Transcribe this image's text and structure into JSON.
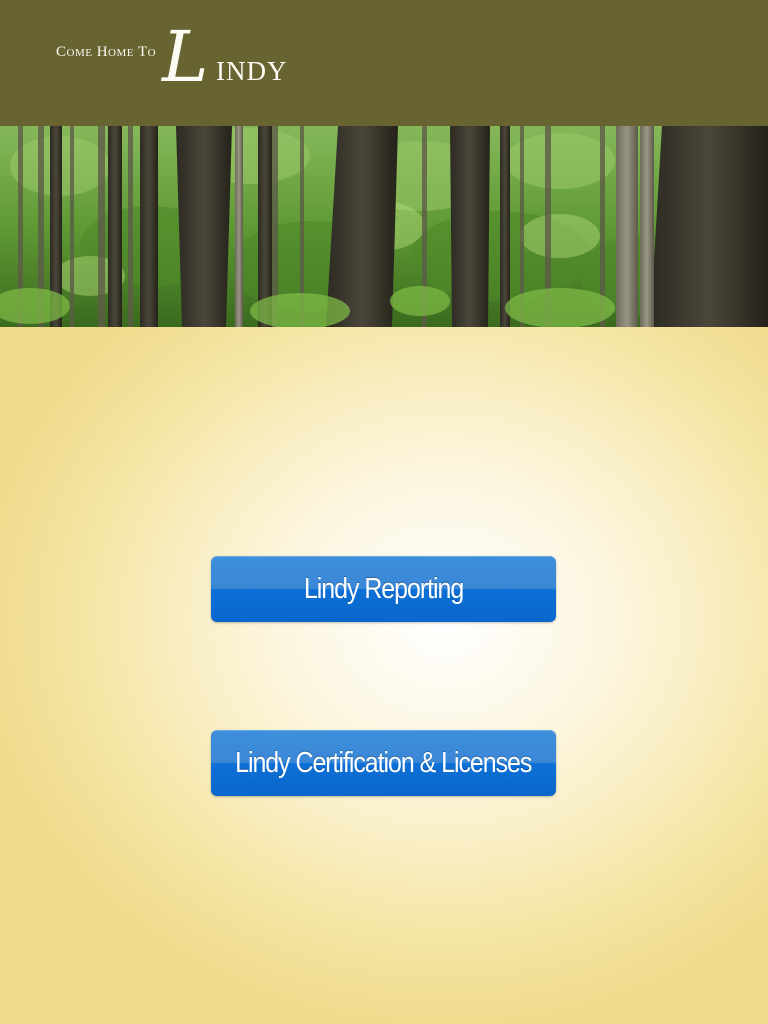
{
  "header": {
    "logo": {
      "prefix": "Come Home To",
      "initial": "L",
      "rest": "INDY"
    },
    "background_color": "#676431"
  },
  "banner": {
    "image_description_icon": "forest-banner-image"
  },
  "buttons": {
    "reporting_label": "Lindy Reporting",
    "certification_label": "Lindy Certification & Licenses"
  },
  "colors": {
    "button_blue": "#0a66cc",
    "background_cream": "#f5e6a6"
  }
}
